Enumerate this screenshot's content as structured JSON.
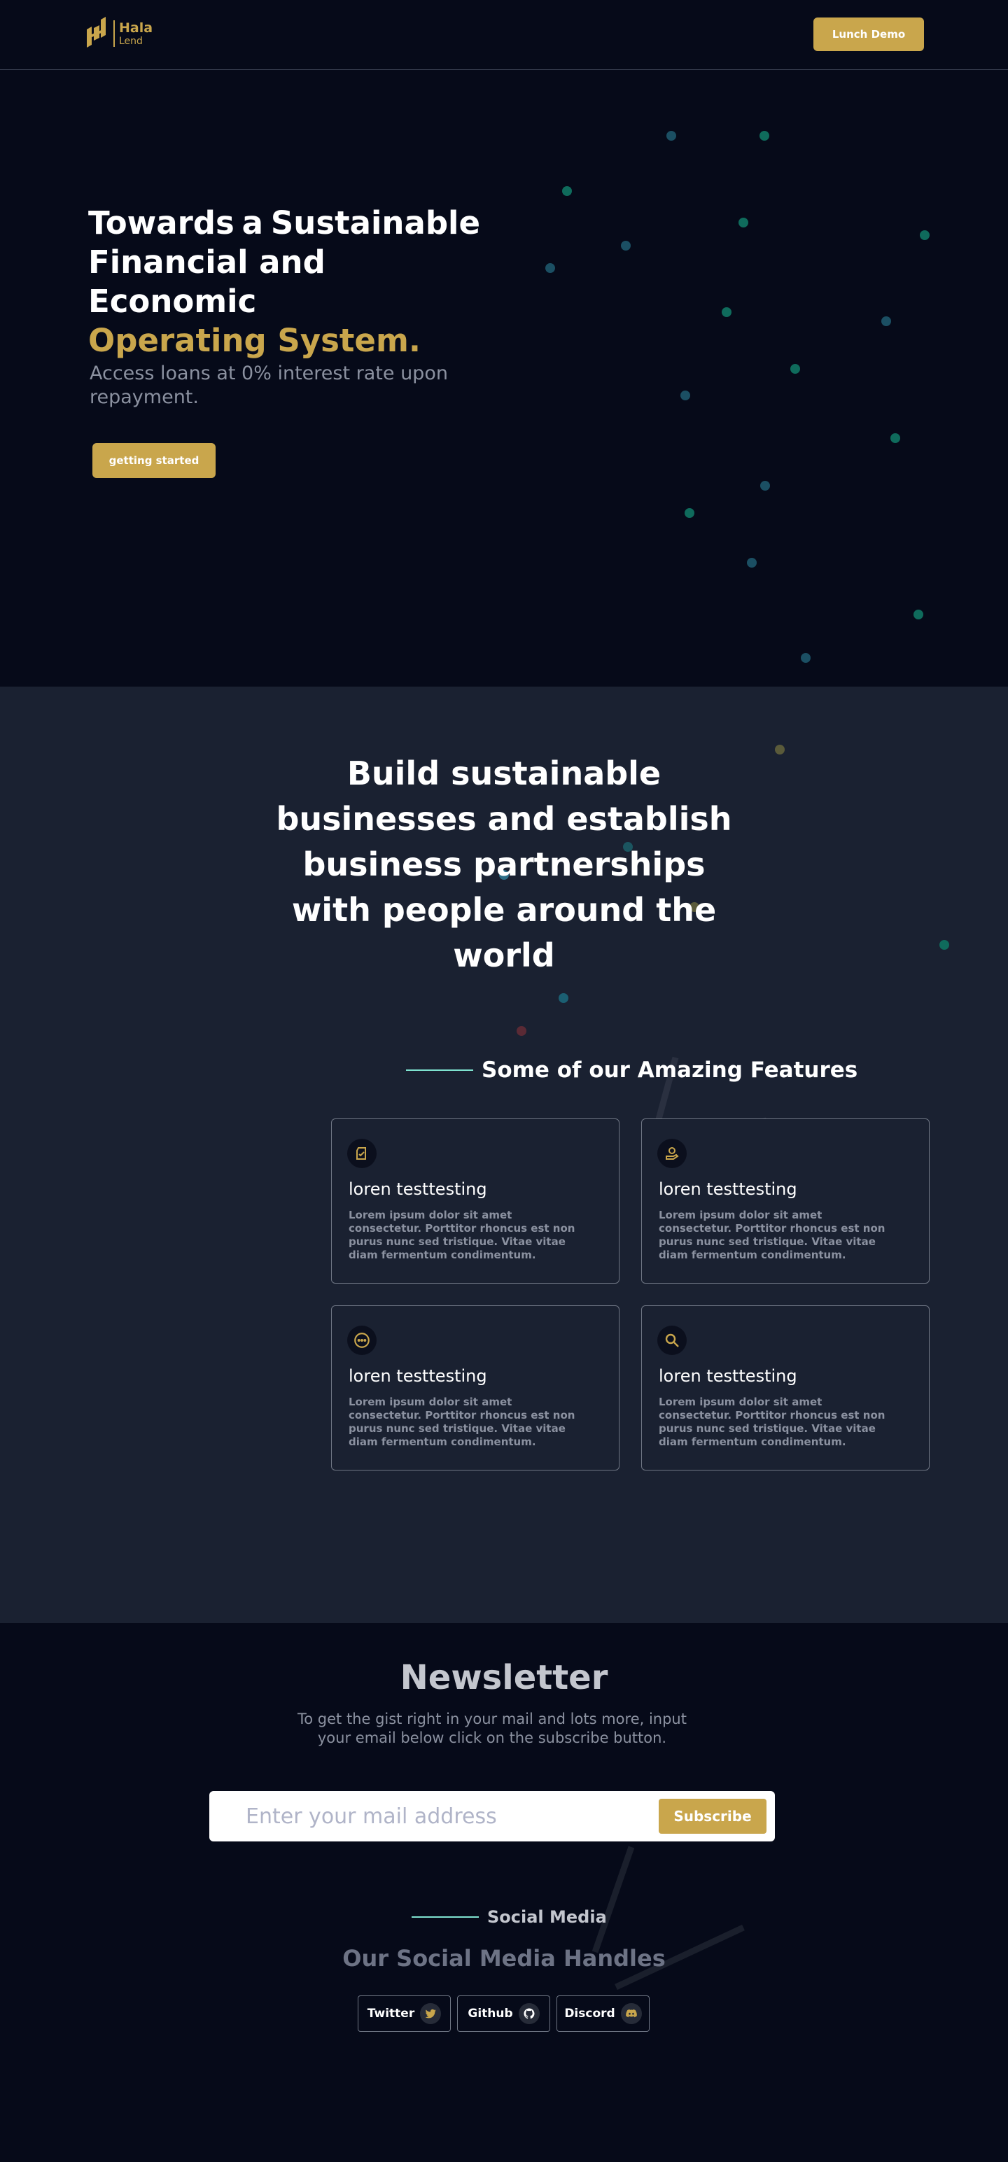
{
  "header": {
    "logo_line1": "Hala",
    "logo_line2": "Lend",
    "demo_label": "Lunch Demo"
  },
  "hero": {
    "title_words": [
      "Towards",
      "a",
      "Sustainable"
    ],
    "title_line2": "Financial and Economic",
    "title_highlight": "Operating System.",
    "subtitle": "Access loans at 0% interest rate upon repayment.",
    "cta_label": "getting started"
  },
  "mission": {
    "title": "Build sustainable businesses and establish business partnerships with people around the world"
  },
  "features": {
    "heading": "Some of our Amazing Features",
    "cards": [
      {
        "icon": "clipboard-check-icon",
        "title": "loren testtesting",
        "body": "Lorem ipsum dolor sit amet consectetur. Porttitor rhoncus est non purus nunc sed tristique. Vitae vitae diam fermentum condimentum."
      },
      {
        "icon": "hand-coin-icon",
        "title": "loren testtesting",
        "body": "Lorem ipsum dolor sit amet consectetur. Porttitor rhoncus est non purus nunc sed tristique. Vitae vitae diam fermentum condimentum."
      },
      {
        "icon": "more-circle-icon",
        "title": "loren testtesting",
        "body": "Lorem ipsum dolor sit amet consectetur. Porttitor rhoncus est non purus nunc sed tristique. Vitae vitae diam fermentum condimentum."
      },
      {
        "icon": "search-icon",
        "title": "loren testtesting",
        "body": "Lorem ipsum dolor sit amet consectetur. Porttitor rhoncus est non purus nunc sed tristique. Vitae vitae diam fermentum condimentum."
      }
    ]
  },
  "newsletter": {
    "title": "Newsletter",
    "subtitle": "To get the gist right in your mail and lots more, input your email below click on the subscribe button.",
    "input_placeholder": "Enter your mail address",
    "subscribe_label": "Subscribe"
  },
  "social": {
    "heading": "Social Media",
    "subheading": "Our Social Media Handles",
    "links": [
      {
        "label": "Twitter",
        "icon": "twitter-icon"
      },
      {
        "label": "Github",
        "icon": "github-icon"
      },
      {
        "label": "Discord",
        "icon": "discord-icon"
      }
    ]
  },
  "colors": {
    "background": "#060a19",
    "section_bg": "#1a2131",
    "accent_gold": "#c9a64c",
    "accent_teal": "#7fe3d0",
    "dot_teal": "#0f6b5c",
    "dot_blue": "#1b4f63"
  }
}
